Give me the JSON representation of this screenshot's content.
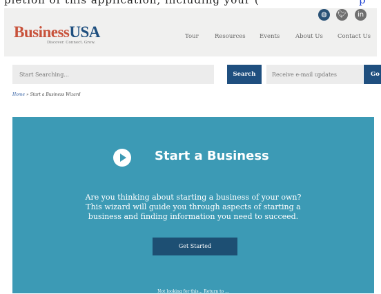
{
  "top_strip": {
    "text": "pletion of this application, including your (",
    "link": "p"
  },
  "header": {
    "logo": {
      "part1": "Business",
      "part2": "USA",
      "tagline": "Discover. Connect. Grow."
    },
    "social": [
      "globe-icon",
      "twitter-icon",
      "linkedin-icon"
    ],
    "nav": [
      "Tour",
      "Resources",
      "Events",
      "About Us",
      "Contact Us"
    ]
  },
  "search": {
    "placeholder": "Start Searching...",
    "button": "Search"
  },
  "email": {
    "placeholder": "Receive e-mail updates",
    "button": "Go"
  },
  "breadcrumb": {
    "home": "Home",
    "separator": " » ",
    "current": "Start a Business Wizard"
  },
  "hero": {
    "title": "Start a Business",
    "description": [
      "Are you thinking about starting a business of your own?",
      "This wizard will guide you through aspects of starting a",
      "business and finding information you need to succeed."
    ],
    "cta": "Get Started",
    "footer_note": "Not looking for this... Return to ..."
  },
  "colors": {
    "brand_red": "#c8523b",
    "brand_blue": "#1f4f7f",
    "hero_bg": "#3c9ab5",
    "header_bg": "#f0f0ef"
  }
}
